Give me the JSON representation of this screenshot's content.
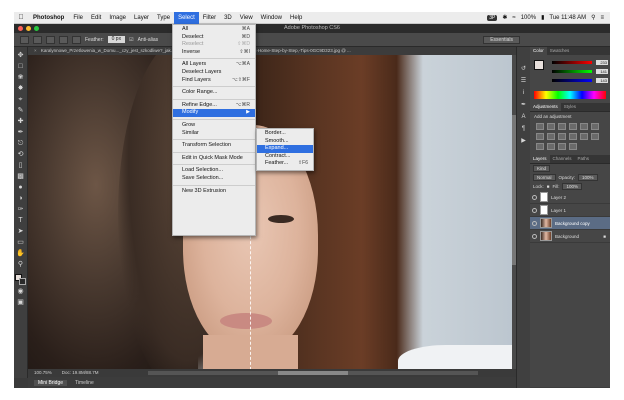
{
  "menubar": {
    "app_name": "Photoshop",
    "items": [
      "File",
      "Edit",
      "Image",
      "Layer",
      "Type",
      "Select",
      "Filter",
      "3D",
      "View",
      "Window",
      "Help"
    ],
    "active_item": "Select",
    "status_badge": "3P",
    "battery": "100%",
    "clock": "Tue 11:48 AM"
  },
  "window": {
    "title": "Adobe Photoshop CS6",
    "document_tab": "Karalynnowe_Przetlowenia_w_Domu..._czy_jest_szkodliwe?_jak... / Brazilian-Blowout-Keratin-Treatment-At-Home-Step-by-Step,-Tips-0GC9D323.jpg @ ..."
  },
  "options_bar": {
    "feather_label": "Feather:",
    "feather_value": "0 px",
    "antialias_label": "Anti-alias",
    "workspace": "Essentials"
  },
  "select_menu": {
    "items": [
      {
        "label": "All",
        "shortcut": "⌘A",
        "disabled": false
      },
      {
        "label": "Deselect",
        "shortcut": "⌘D",
        "disabled": false
      },
      {
        "label": "Reselect",
        "shortcut": "⇧⌘D",
        "disabled": true
      },
      {
        "label": "Inverse",
        "shortcut": "⇧⌘I",
        "disabled": false
      },
      {
        "sep": true
      },
      {
        "label": "All Layers",
        "shortcut": "⌥⌘A",
        "disabled": false
      },
      {
        "label": "Deselect Layers",
        "shortcut": "",
        "disabled": false
      },
      {
        "label": "Find Layers",
        "shortcut": "⌥⇧⌘F",
        "disabled": false
      },
      {
        "sep": true
      },
      {
        "label": "Color Range...",
        "shortcut": "",
        "disabled": false
      },
      {
        "sep": true
      },
      {
        "label": "Refine Edge...",
        "shortcut": "⌥⌘R",
        "disabled": false
      },
      {
        "label": "Modify",
        "shortcut": "▶",
        "disabled": false,
        "active": true
      },
      {
        "sep": true
      },
      {
        "label": "Grow",
        "shortcut": "",
        "disabled": false
      },
      {
        "label": "Similar",
        "shortcut": "",
        "disabled": false
      },
      {
        "sep": true
      },
      {
        "label": "Transform Selection",
        "shortcut": "",
        "disabled": false
      },
      {
        "sep": true
      },
      {
        "label": "Edit in Quick Mask Mode",
        "shortcut": "",
        "disabled": false
      },
      {
        "sep": true
      },
      {
        "label": "Load Selection...",
        "shortcut": "",
        "disabled": false
      },
      {
        "label": "Save Selection...",
        "shortcut": "",
        "disabled": false
      },
      {
        "sep": true
      },
      {
        "label": "New 3D Extrusion",
        "shortcut": "",
        "disabled": false
      }
    ]
  },
  "modify_submenu": {
    "items": [
      {
        "label": "Border...",
        "shortcut": ""
      },
      {
        "label": "Smooth...",
        "shortcut": ""
      },
      {
        "label": "Expand...",
        "shortcut": "",
        "active": true
      },
      {
        "label": "Contract...",
        "shortcut": ""
      },
      {
        "label": "Feather...",
        "shortcut": "⇧F6"
      }
    ]
  },
  "color_panel": {
    "tabs": [
      "Color",
      "Swatches"
    ],
    "r": "233",
    "g": "141",
    "b": "143"
  },
  "adjustments_panel": {
    "tabs": [
      "Adjustments",
      "Styles"
    ],
    "label": "Add an adjustment"
  },
  "layers_panel": {
    "tabs": [
      "Layers",
      "Channels",
      "Paths"
    ],
    "kind_filter": "Kind",
    "blend_mode": "Normal",
    "opacity_label": "Opacity:",
    "opacity": "100%",
    "lock_label": "Lock:",
    "fill_label": "Fill:",
    "fill": "100%",
    "layers": [
      {
        "name": "Layer 2",
        "selected": false,
        "kind": "mask"
      },
      {
        "name": "Layer 1",
        "selected": false,
        "kind": "mask"
      },
      {
        "name": "Background copy",
        "selected": true,
        "kind": "photo"
      },
      {
        "name": "Background",
        "selected": false,
        "kind": "photo"
      }
    ]
  },
  "status_bar": {
    "zoom": "100.75%",
    "doc_size": "Doc: 19.8M/88.7M"
  },
  "bottom_tabs": [
    "Mini Bridge",
    "Timeline"
  ],
  "colors": {
    "menu_highlight": "#2f6fe0",
    "layer_selected": "#5b6c85"
  }
}
